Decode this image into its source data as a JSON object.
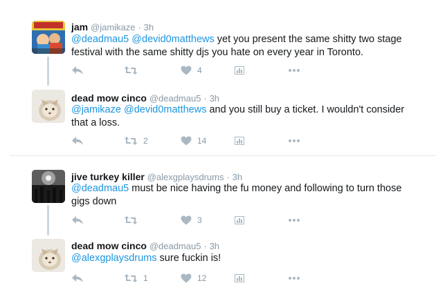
{
  "tweets": [
    {
      "name": "jam",
      "handle": "@jamikaze",
      "separator": "·",
      "time": "3h",
      "mentions": [
        "@deadmau5",
        "@devid0matthews"
      ],
      "text": " yet you present the same shitty two stage festival with the same shitty djs you hate on every year in Toronto.",
      "retweets": "",
      "likes": "4",
      "avatar": "comic-art-avatar"
    },
    {
      "name": "dead mow cinco",
      "handle": "@deadmau5",
      "separator": "·",
      "time": "3h",
      "mentions": [
        "@jamikaze",
        "@devid0matthews"
      ],
      "text": " and you still buy a ticket. I wouldn't consider that a loss.",
      "retweets": "2",
      "likes": "14",
      "avatar": "cat-avatar"
    },
    {
      "name": "jive turkey killer",
      "handle": "@alexgplaysdrums",
      "separator": "·",
      "time": "3h",
      "mentions": [
        "@deadmau5"
      ],
      "text": " must be nice having the fu money and following to turn those gigs down",
      "retweets": "",
      "likes": "3",
      "avatar": "concert-avatar"
    },
    {
      "name": "dead mow cinco",
      "handle": "@deadmau5",
      "separator": "·",
      "time": "3h",
      "mentions": [
        "@alexgplaysdrums"
      ],
      "text": " sure fuckin is!",
      "retweets": "1",
      "likes": "12",
      "avatar": "cat-avatar"
    }
  ],
  "colors": {
    "link": "#1b95e0",
    "muted": "#8899a6",
    "icon": "#aab8c2",
    "thread_line": "#ccd6dd",
    "divider": "#e1e8ed"
  }
}
